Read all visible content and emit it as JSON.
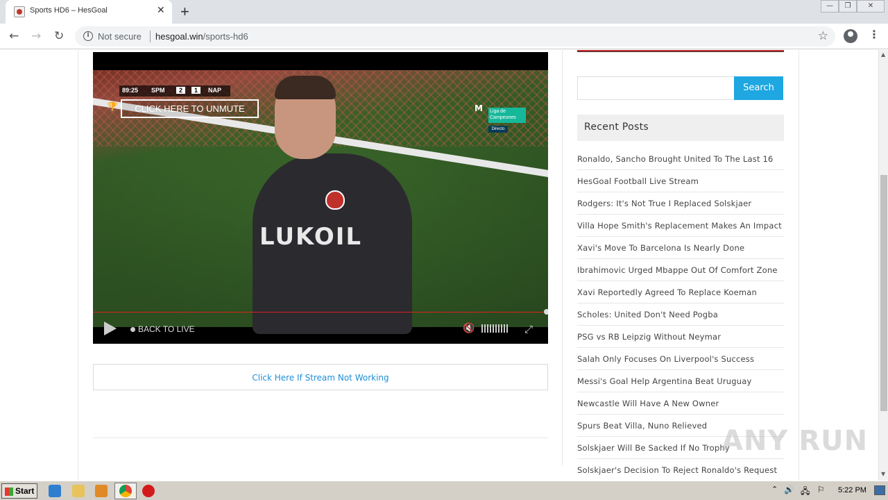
{
  "browser": {
    "tab_title": "Sports HD6 – HesGoal",
    "tab_close": "✕",
    "new_tab": "+",
    "security_label": "Not secure",
    "url_host": "hesgoal.win",
    "url_path": "/sports-hd6",
    "window_controls": [
      "—",
      "❐",
      "✕"
    ]
  },
  "player": {
    "scorebug": {
      "time": "89:25",
      "team_home": "SPM",
      "score_home": "2",
      "score_away": "1",
      "team_away": "NAP"
    },
    "unmute_label": "CLICK HERE TO UNMUTE",
    "broadcaster_box": "Liga de Campeones",
    "broadcaster_live": "Directo",
    "sponsor": "LUKOIL",
    "back_to_live": "BACK TO LIVE"
  },
  "stream_link": "Click Here If Stream Not Working",
  "sidebar": {
    "search_placeholder": "",
    "search_button": "Search",
    "recent_posts_title": "Recent Posts",
    "recent_posts": [
      "Ronaldo, Sancho Brought United To The Last 16",
      "HesGoal Football Live Stream",
      "Rodgers: It's Not True I Replaced Solskjaer",
      "Villa Hope Smith's Replacement Makes An Impact",
      "Xavi's Move To Barcelona Is Nearly Done",
      "Ibrahimovic Urged Mbappe Out Of Comfort Zone",
      "Xavi Reportedly Agreed To Replace Koeman",
      "Scholes: United Don't Need Pogba",
      "PSG vs RB Leipzig Without Neymar",
      "Salah Only Focuses On Liverpool's Success",
      "Messi's Goal Help Argentina Beat Uruguay",
      "Newcastle Will Have A New Owner",
      "Spurs Beat Villa, Nuno Relieved",
      "Solskjaer Will Be Sacked If No Trophy",
      "Solskjaer's Decision To Reject Ronaldo's Request"
    ]
  },
  "watermark": "ANY RUN",
  "taskbar": {
    "start_label": "Start",
    "clock": "5:22 PM"
  },
  "colors": {
    "accent": "#1ea7e1",
    "link": "#1e8fd6",
    "progress": "#e02020"
  }
}
